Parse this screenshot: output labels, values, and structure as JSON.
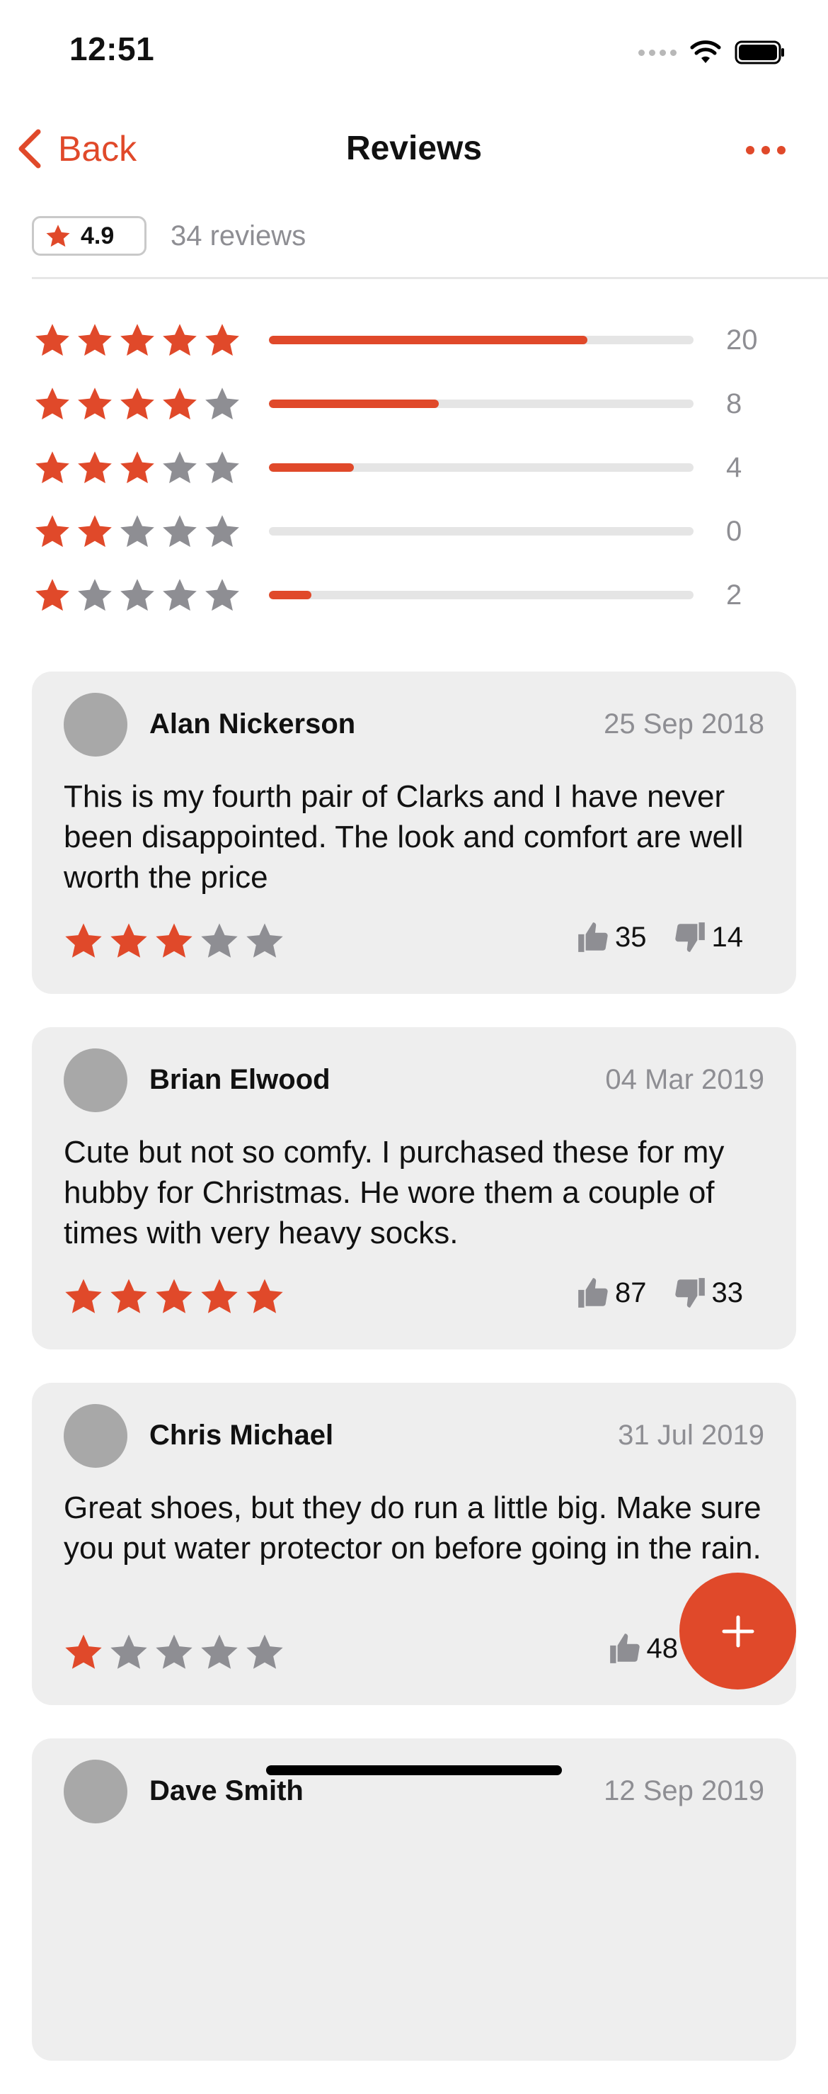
{
  "status_bar": {
    "time": "12:51"
  },
  "nav": {
    "back_label": "Back",
    "title": "Reviews",
    "more_icon": "ellipsis-icon"
  },
  "summary": {
    "rating": "4.9",
    "review_count_text": "34 reviews",
    "breakdown": [
      {
        "stars": 5,
        "count": "20",
        "fraction": 0.75
      },
      {
        "stars": 4,
        "count": "8",
        "fraction": 0.4
      },
      {
        "stars": 3,
        "count": "4",
        "fraction": 0.2
      },
      {
        "stars": 2,
        "count": "0",
        "fraction": 0.0
      },
      {
        "stars": 1,
        "count": "2",
        "fraction": 0.1
      }
    ]
  },
  "reviews": [
    {
      "author": "Alan Nickerson",
      "date": "25 Sep 2018",
      "text": "This is my fourth pair of Clarks and I have never been disappointed. The look and comfort are well worth the price",
      "rating": 3,
      "likes": "35",
      "dislikes": "14"
    },
    {
      "author": "Brian Elwood",
      "date": "04 Mar 2019",
      "text": "Cute but not so comfy. I purchased these for my hubby for Christmas. He wore them a couple of times with very heavy socks.",
      "rating": 5,
      "likes": "87",
      "dislikes": "33"
    },
    {
      "author": "Chris Michael",
      "date": "31 Jul 2019",
      "text": "Great shoes, but they do run a little big. Make sure you put water protector on before going in the rain.",
      "rating": 1,
      "likes": "48",
      "dislikes": ""
    },
    {
      "author": "Dave Smith",
      "date": "12 Sep 2019",
      "text": "",
      "rating": 0,
      "likes": "",
      "dislikes": ""
    }
  ],
  "colors": {
    "accent": "#e0492a",
    "star_inactive": "#8e8e93",
    "card_bg": "#eeeeee",
    "secondary_text": "#8e8e93"
  },
  "fab": {
    "icon": "plus-icon"
  }
}
